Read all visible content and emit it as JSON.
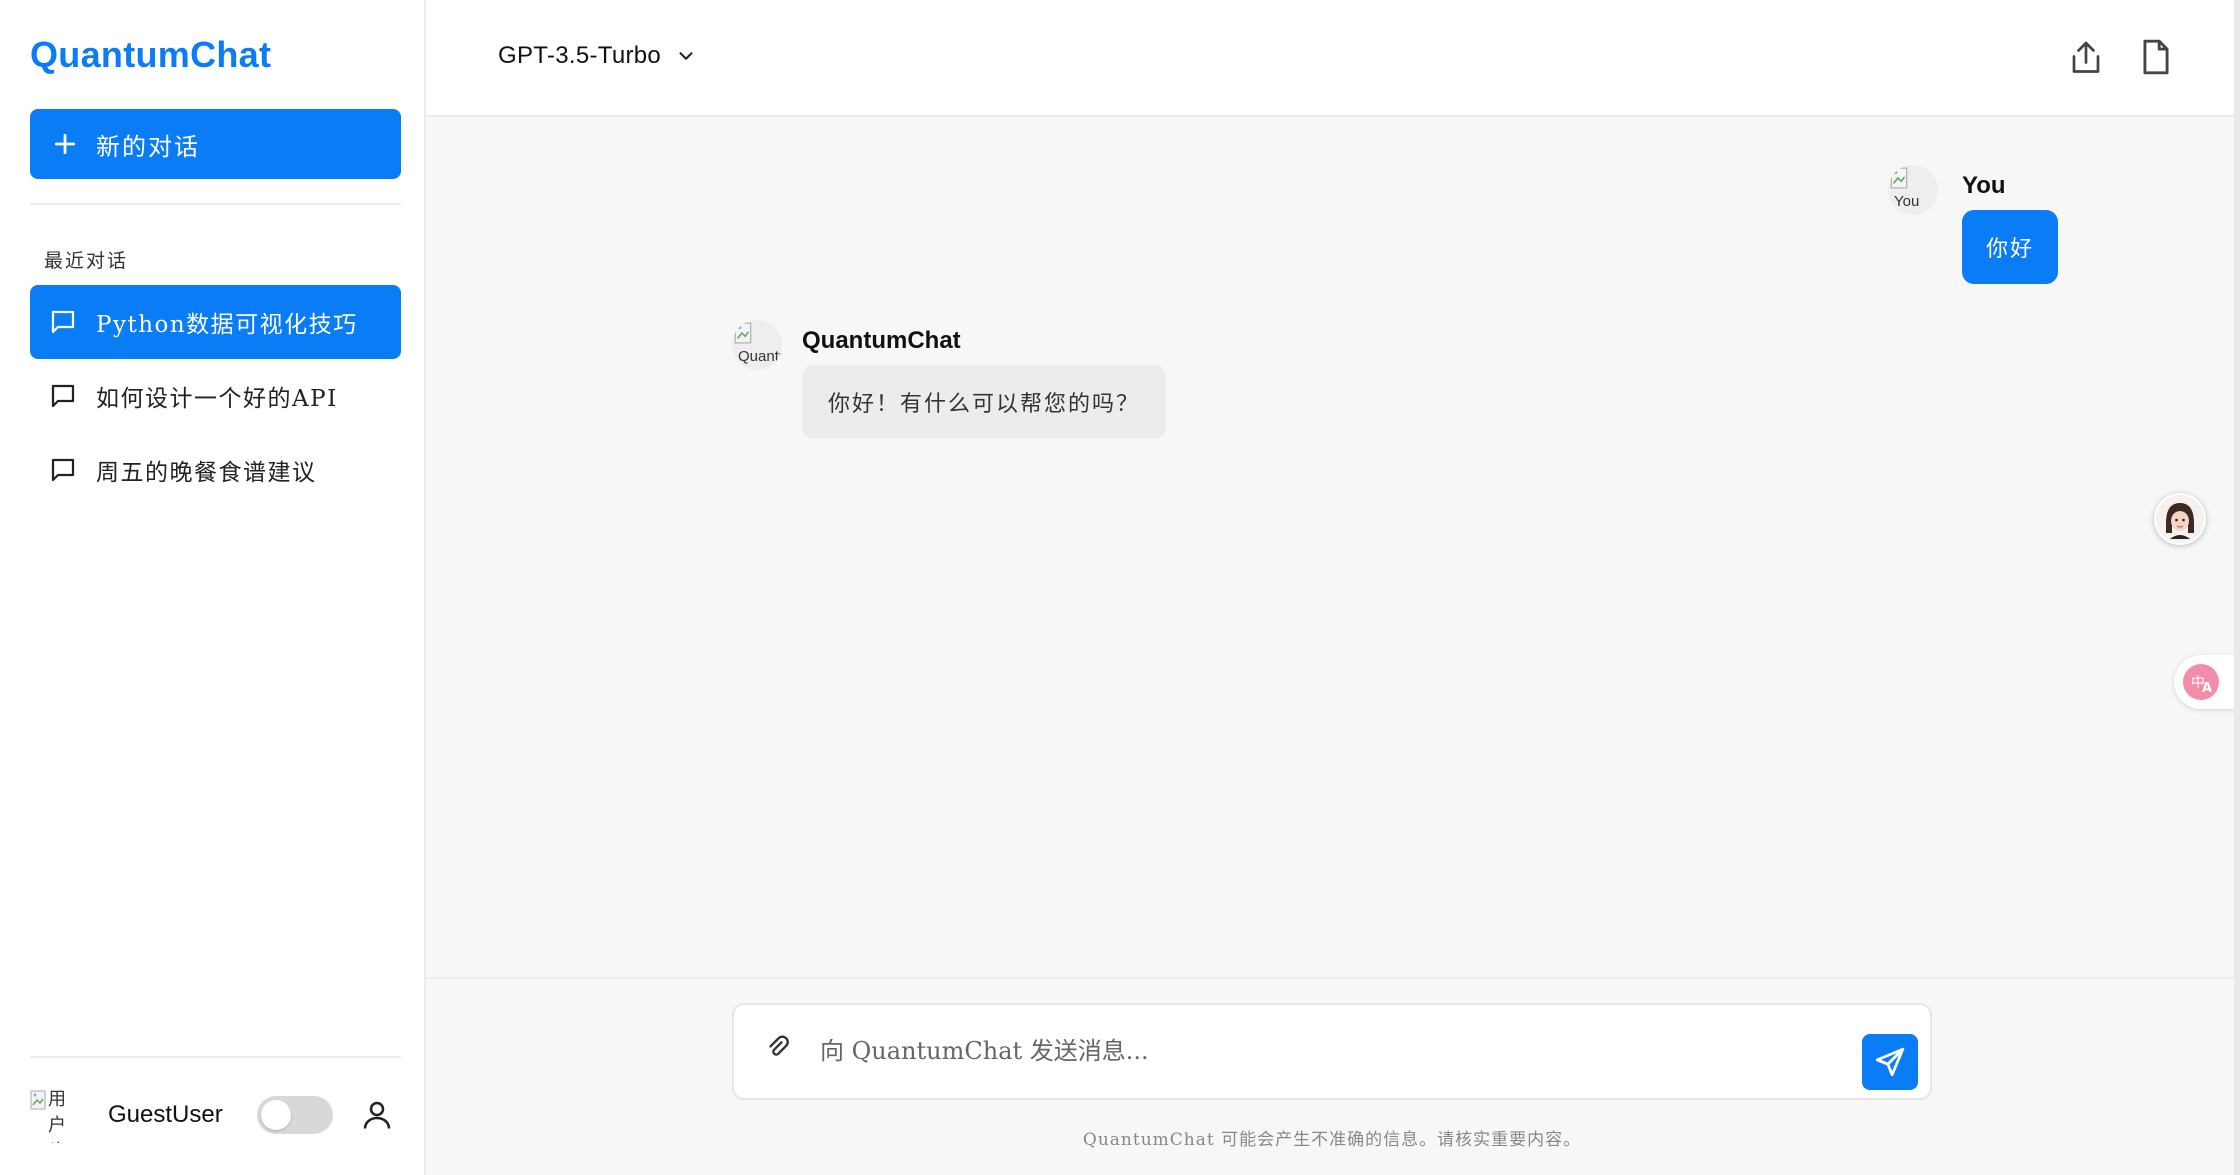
{
  "app": {
    "brand": "QuantumChat",
    "accent_color": "#0a7cf5"
  },
  "sidebar": {
    "new_chat_label": "新的对话",
    "recent_title": "最近对话",
    "conversations": [
      {
        "label": "Python数据可视化技巧",
        "active": true
      },
      {
        "label": "如何设计一个好的API",
        "active": false
      },
      {
        "label": "周五的晚餐食谱建议",
        "active": false
      }
    ],
    "user": {
      "avatar_alt": "用户头像",
      "name": "GuestUser",
      "toggle_on": false
    }
  },
  "header": {
    "model": "GPT-3.5-Turbo"
  },
  "messages": [
    {
      "role": "user",
      "sender": "You",
      "avatar_alt": "You",
      "text": "你好"
    },
    {
      "role": "assistant",
      "sender": "QuantumChat",
      "avatar_alt": "QuantumChat",
      "text": "你好！有什么可以帮您的吗？"
    }
  ],
  "composer": {
    "placeholder": "向 QuantumChat 发送消息...",
    "disclaimer": "QuantumChat 可能会产生不准确的信息。请核实重要内容。"
  },
  "icons": {
    "new_chat": "plus-icon",
    "conversation": "message-square-icon",
    "model_dropdown": "chevron-down-icon",
    "share": "share-upload-icon",
    "document": "file-icon",
    "attach": "paperclip-icon",
    "send": "send-icon",
    "profile": "user-icon",
    "translate": "translate-icon"
  }
}
